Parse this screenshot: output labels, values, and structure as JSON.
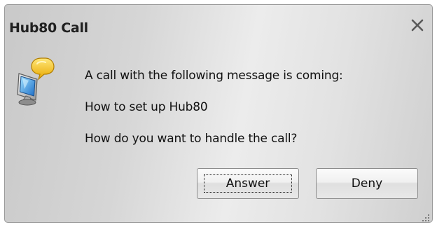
{
  "window": {
    "title": "Hub80 Call",
    "close_glyph": "✕"
  },
  "message": {
    "line1": "A call with the following message is coming:",
    "line2": "How to set up Hub80",
    "line3": "How do you want to handle the call?"
  },
  "buttons": {
    "answer_label": "Answer",
    "deny_label": "Deny"
  },
  "icons": {
    "app": "computer-chat-icon",
    "close": "close-icon",
    "resize": "resize-grip-icon"
  },
  "colors": {
    "dialog_background": "#e0e0e0",
    "speech_bubble": "#f2c218",
    "monitor_screen": "#3aa0e8"
  }
}
